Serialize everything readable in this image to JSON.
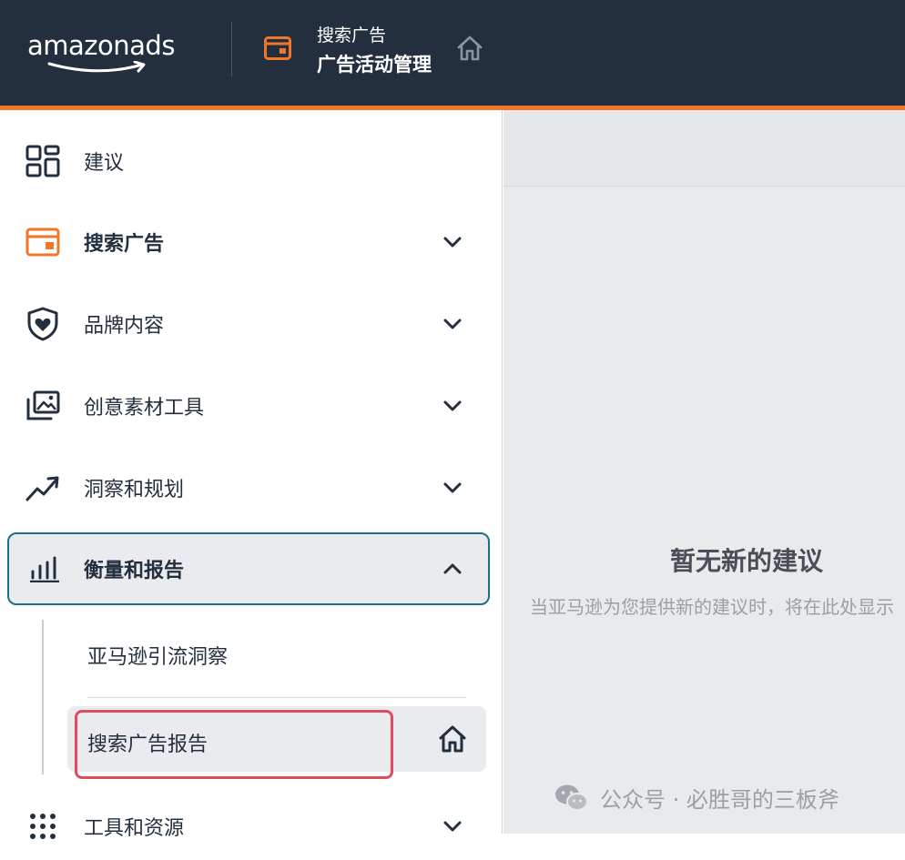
{
  "header": {
    "logo_text": "amazonads",
    "breadcrumb": "搜索广告",
    "title": "广告活动管理"
  },
  "sidebar": {
    "items": [
      {
        "label": "建议",
        "icon": "grid-icon"
      },
      {
        "label": "搜索广告",
        "icon": "campaign-card-icon"
      },
      {
        "label": "品牌内容",
        "icon": "shield-heart-icon"
      },
      {
        "label": "创意素材工具",
        "icon": "image-stack-icon"
      },
      {
        "label": "洞察和规划",
        "icon": "trend-line-icon"
      },
      {
        "label": "衡量和报告",
        "icon": "bar-chart-icon"
      },
      {
        "label": "工具和资源",
        "icon": "dots-grid-icon"
      }
    ],
    "sub_items": [
      {
        "label": "亚马逊引流洞察"
      },
      {
        "label": "搜索广告报告"
      }
    ]
  },
  "main": {
    "empty_title": "暂无新的建议",
    "empty_desc": "当亚马逊为您提供新的建议时，将在此处显示"
  },
  "watermark": "公众号 · 必胜哥的三板斧",
  "colors": {
    "topbar": "#232f3e",
    "accent": "#f0772a",
    "active_border": "#1f6f8b",
    "highlight": "#e14b5e"
  }
}
